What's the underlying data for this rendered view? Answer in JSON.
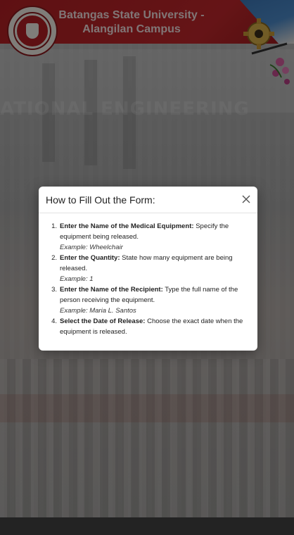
{
  "header": {
    "title_line1": "Batangas State University -",
    "title_line2": "Alangilan Campus",
    "background_text": "ATIONAL ENGINEERING"
  },
  "modal": {
    "title": "How to Fill Out the Form:",
    "close_icon": "close-icon",
    "steps": [
      {
        "number": "1.",
        "label": "Enter the Name of the Medical Equipment:",
        "text": " Specify the equipment being released.",
        "example": "Example: Wheelchair"
      },
      {
        "number": "2.",
        "label": "Enter the Quantity:",
        "text": " State how many equipment are being released.",
        "example": "Example: 1"
      },
      {
        "number": "3.",
        "label": "Enter the Name of the Recipient:",
        "text": " Type the full name of the person receiving the equipment.",
        "example": "Example: Maria L. Santos"
      },
      {
        "number": "4.",
        "label": "Select the Date of Release:",
        "text": " Choose the exact date when the equipment is released.",
        "example": ""
      }
    ]
  },
  "colors": {
    "brand_red": "#b52025",
    "overlay": "rgba(0,0,0,0.48)"
  }
}
